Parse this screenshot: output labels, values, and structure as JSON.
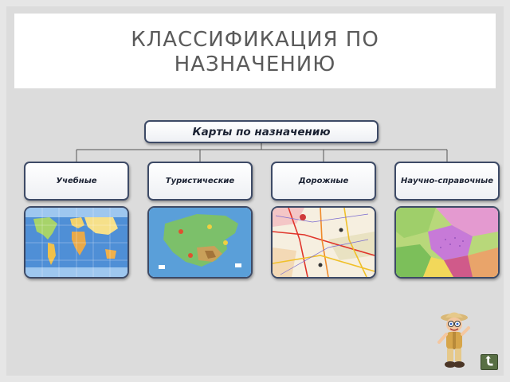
{
  "slide": {
    "title": "КЛАССИФИКАЦИЯ  ПО\nНАЗНАЧЕНИЮ"
  },
  "diagram": {
    "root_label": "Карты по назначению",
    "categories": [
      {
        "label": "Учебные",
        "image": "world-map-image"
      },
      {
        "label": "Туристические",
        "image": "crimea-tourist-map-image"
      },
      {
        "label": "Дорожные",
        "image": "road-map-image"
      },
      {
        "label": "Научно-справочные",
        "image": "geological-map-image"
      }
    ]
  },
  "decorations": {
    "character": "explorer-character",
    "nav_icon": "back-arrow-icon"
  },
  "colors": {
    "box_border": "#3d4a66",
    "title_text": "#5a5a5a",
    "background": "#dcdcdc"
  }
}
